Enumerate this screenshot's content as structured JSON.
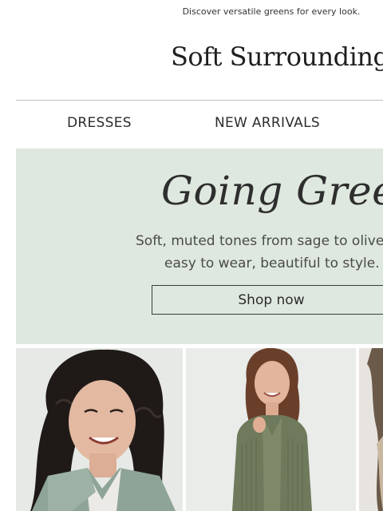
{
  "preheader": "Discover versatile greens for every look.",
  "brand": "Soft Surroundings",
  "nav": [
    {
      "label": "DRESSES"
    },
    {
      "label": "NEW ARRIVALS"
    }
  ],
  "hero": {
    "title": "Going Green",
    "body_line1": "Soft, muted tones from sage to olive,",
    "body_line2": "easy to wear, beautiful to style.",
    "cta": "Shop now",
    "bg_color": "#dfe8df"
  },
  "products": [
    {
      "image": "woman-curly-hair-sage-jacket"
    },
    {
      "image": "woman-olive-ribbed-cardigan"
    },
    {
      "image": "woman-partial-crop"
    }
  ]
}
